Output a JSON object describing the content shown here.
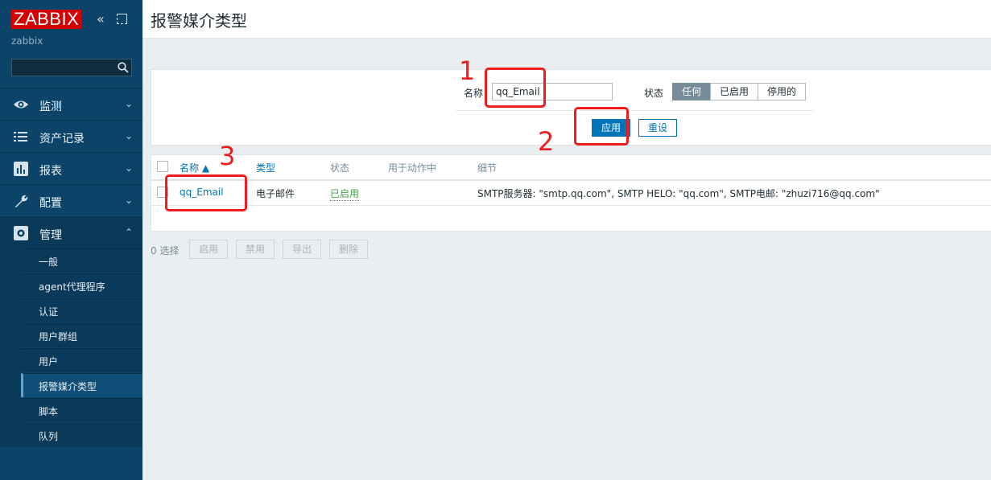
{
  "app": {
    "logo": "ZABBIX",
    "server_name": "zabbix"
  },
  "sidebar": {
    "search_value": "",
    "items": [
      {
        "label": "监测",
        "icon": "eye-icon"
      },
      {
        "label": "资产记录",
        "icon": "list-icon"
      },
      {
        "label": "报表",
        "icon": "report-icon"
      },
      {
        "label": "配置",
        "icon": "wrench-icon"
      },
      {
        "label": "管理",
        "icon": "gear-icon"
      }
    ],
    "submenu": [
      "一般",
      "agent代理程序",
      "认证",
      "用户群组",
      "用户",
      "报警媒介类型",
      "脚本",
      "队列"
    ]
  },
  "page": {
    "title": "报警媒介类型"
  },
  "filter": {
    "name_label": "名称",
    "name_value": "qq_Email",
    "status_label": "状态",
    "status_options": [
      "任何",
      "已启用",
      "停用的"
    ],
    "status_selected": "任何",
    "apply": "应用",
    "reset": "重设"
  },
  "table": {
    "columns": [
      "名称 ▲",
      "类型",
      "状态",
      "用于动作中",
      "细节"
    ],
    "rows": [
      {
        "name": "qq_Email",
        "type": "电子邮件",
        "status": "已启用",
        "used_in_actions": "",
        "details": "SMTP服务器: \"smtp.qq.com\", SMTP HELO: \"qq.com\", SMTP电邮: \"zhuzi716@qq.com\""
      }
    ]
  },
  "bottom": {
    "selected": "0 选择",
    "actions": [
      "启用",
      "禁用",
      "导出",
      "删除"
    ]
  },
  "annotations": [
    "1",
    "2",
    "3"
  ],
  "colors": {
    "sidebar": "#0b4468",
    "accent": "#0275b8",
    "logo": "#d40000",
    "enabled": "#429e47",
    "annotation": "#ee1c1c"
  }
}
